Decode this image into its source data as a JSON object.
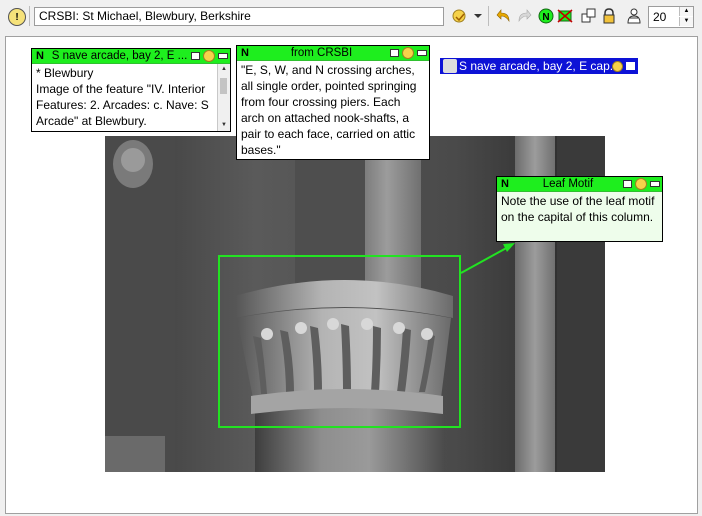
{
  "toolbar": {
    "info_icon_glyph": "!",
    "title_value": "CRSBI: St Michael, Blewbury, Berkshire",
    "zoom_value": "20",
    "icons": [
      "info-icon",
      "view-menu-icon",
      "dropdown-icon",
      "undo-icon",
      "redo-icon",
      "new-note-icon",
      "hide-notes-icon",
      "fit-icon",
      "lock-icon",
      "users-icon"
    ]
  },
  "notes": {
    "blewbury": {
      "title": "S nave arcade, bay 2, E ...",
      "lines": [
        "* Blewbury",
        "Image of the feature \"IV. Interior",
        "Features: 2. Arcades: c. Nave: S",
        "Arcade\" at Blewbury."
      ]
    },
    "crsbi": {
      "title": "from CRSBI",
      "text": "\"E, S, W, and N crossing arches, all single order, pointed springing from four crossing piers.  Each arch on attached nook-shafts, a pair to each face, carried on attic bases.\""
    },
    "leaf": {
      "title": "Leaf Motif",
      "text": "Note the use of the leaf motif on the capital of this column."
    },
    "tag": {
      "title": "S nave arcade, bay 2, E cap..."
    }
  },
  "colors": {
    "note_header": "#1eee1e",
    "region": "#22e322",
    "tag_note": "#0d12d6"
  }
}
